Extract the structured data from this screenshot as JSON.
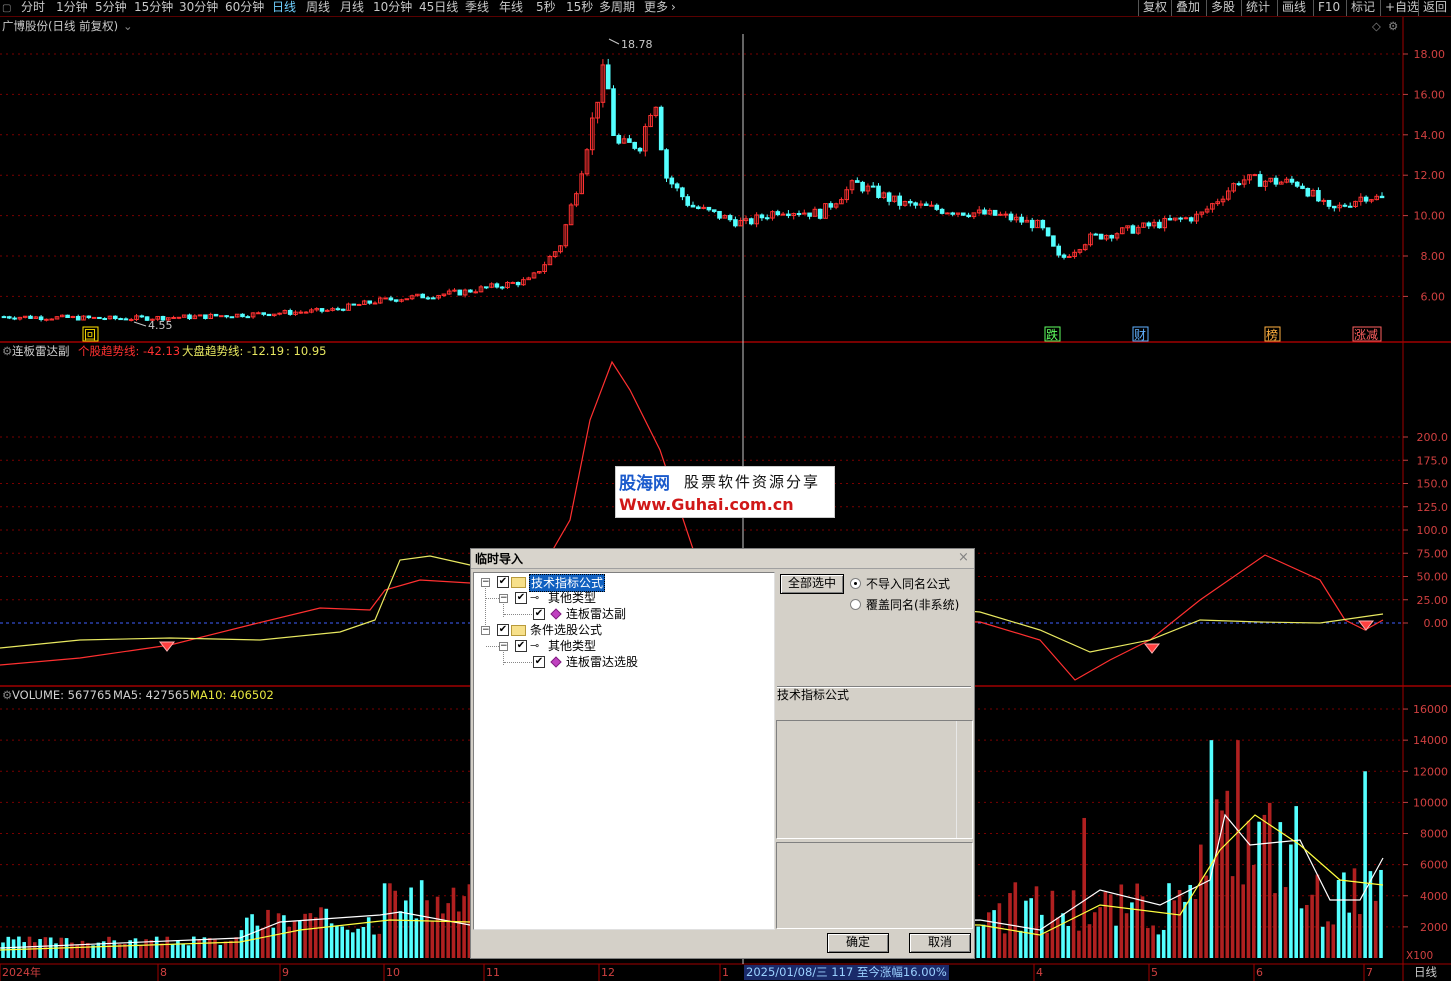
{
  "toolbar": {
    "periods": [
      "分时",
      "1分钟",
      "5分钟",
      "15分钟",
      "30分钟",
      "60分钟",
      "日线",
      "周线",
      "月线",
      "10分钟",
      "45日线",
      "季线",
      "年线",
      "5秒",
      "15秒",
      "多周期",
      "更多"
    ],
    "active": "日线",
    "right_buttons": [
      "复权",
      "叠加",
      "多股",
      "统计",
      "画线",
      "F10",
      "标记",
      "+自选",
      "返回"
    ]
  },
  "price_panel": {
    "title": "广博股份(日线 前复权)",
    "y_ticks": [
      "18.00",
      "16.00",
      "14.00",
      "12.00",
      "10.00",
      "8.00",
      "6.00"
    ],
    "high_label": "18.78",
    "low_label": "4.55",
    "marks": [
      "回",
      "跌",
      "财",
      "榜",
      "涨减"
    ]
  },
  "indicator_panel": {
    "name": "连板雷达副",
    "line1_label": "个股趋势线:",
    "line1_value": "-42.13",
    "line2_label": "大盘趋势线:",
    "line2_value": "-12.19",
    "extra_value": ": 10.95",
    "y_ticks": [
      "200.0",
      "175.0",
      "150.0",
      "125.0",
      "100.0",
      "75.00",
      "50.00",
      "25.00",
      "0.00"
    ]
  },
  "volume_panel": {
    "volume_label": "VOLUME: 567765",
    "ma5_label": "MA5: 427565",
    "ma10_label": "MA10: 406502",
    "y_ticks": [
      "16000",
      "14000",
      "12000",
      "10000",
      "8000",
      "6000",
      "4000",
      "2000"
    ],
    "unit": "X100"
  },
  "x_axis": {
    "labels": [
      "2024年",
      "8",
      "9",
      "10",
      "11",
      "12",
      "1",
      "4",
      "5",
      "6",
      "7"
    ],
    "status": "2025/01/08/三 117 至今涨幅16.00%",
    "period": "日线"
  },
  "watermark": {
    "brand": "股海网",
    "slogan": "股票软件资源分享",
    "url": "Www.Guhai.com.cn"
  },
  "dialog": {
    "title": "临时导入",
    "close": "×",
    "tree": [
      {
        "label": "技术指标公式",
        "selected": true
      },
      {
        "label": "其他类型"
      },
      {
        "label": "连板雷达副"
      },
      {
        "label": "条件选股公式"
      },
      {
        "label": "其他类型"
      },
      {
        "label": "连板雷达选股"
      }
    ],
    "select_all": "全部选中",
    "radio_options": [
      "不导入同名公式",
      "覆盖同名(非系统)"
    ],
    "radio_selected": 0,
    "category_label": "技术指标公式",
    "ok": "确定",
    "cancel": "取消"
  },
  "colors": {
    "up": "#ff3232",
    "down": "#54ffff",
    "grid": "#7a0000",
    "individual_trend": "#ff3030",
    "market_trend": "#e8e860",
    "ma5": "#ffffff",
    "ma10": "#ffff40"
  }
}
